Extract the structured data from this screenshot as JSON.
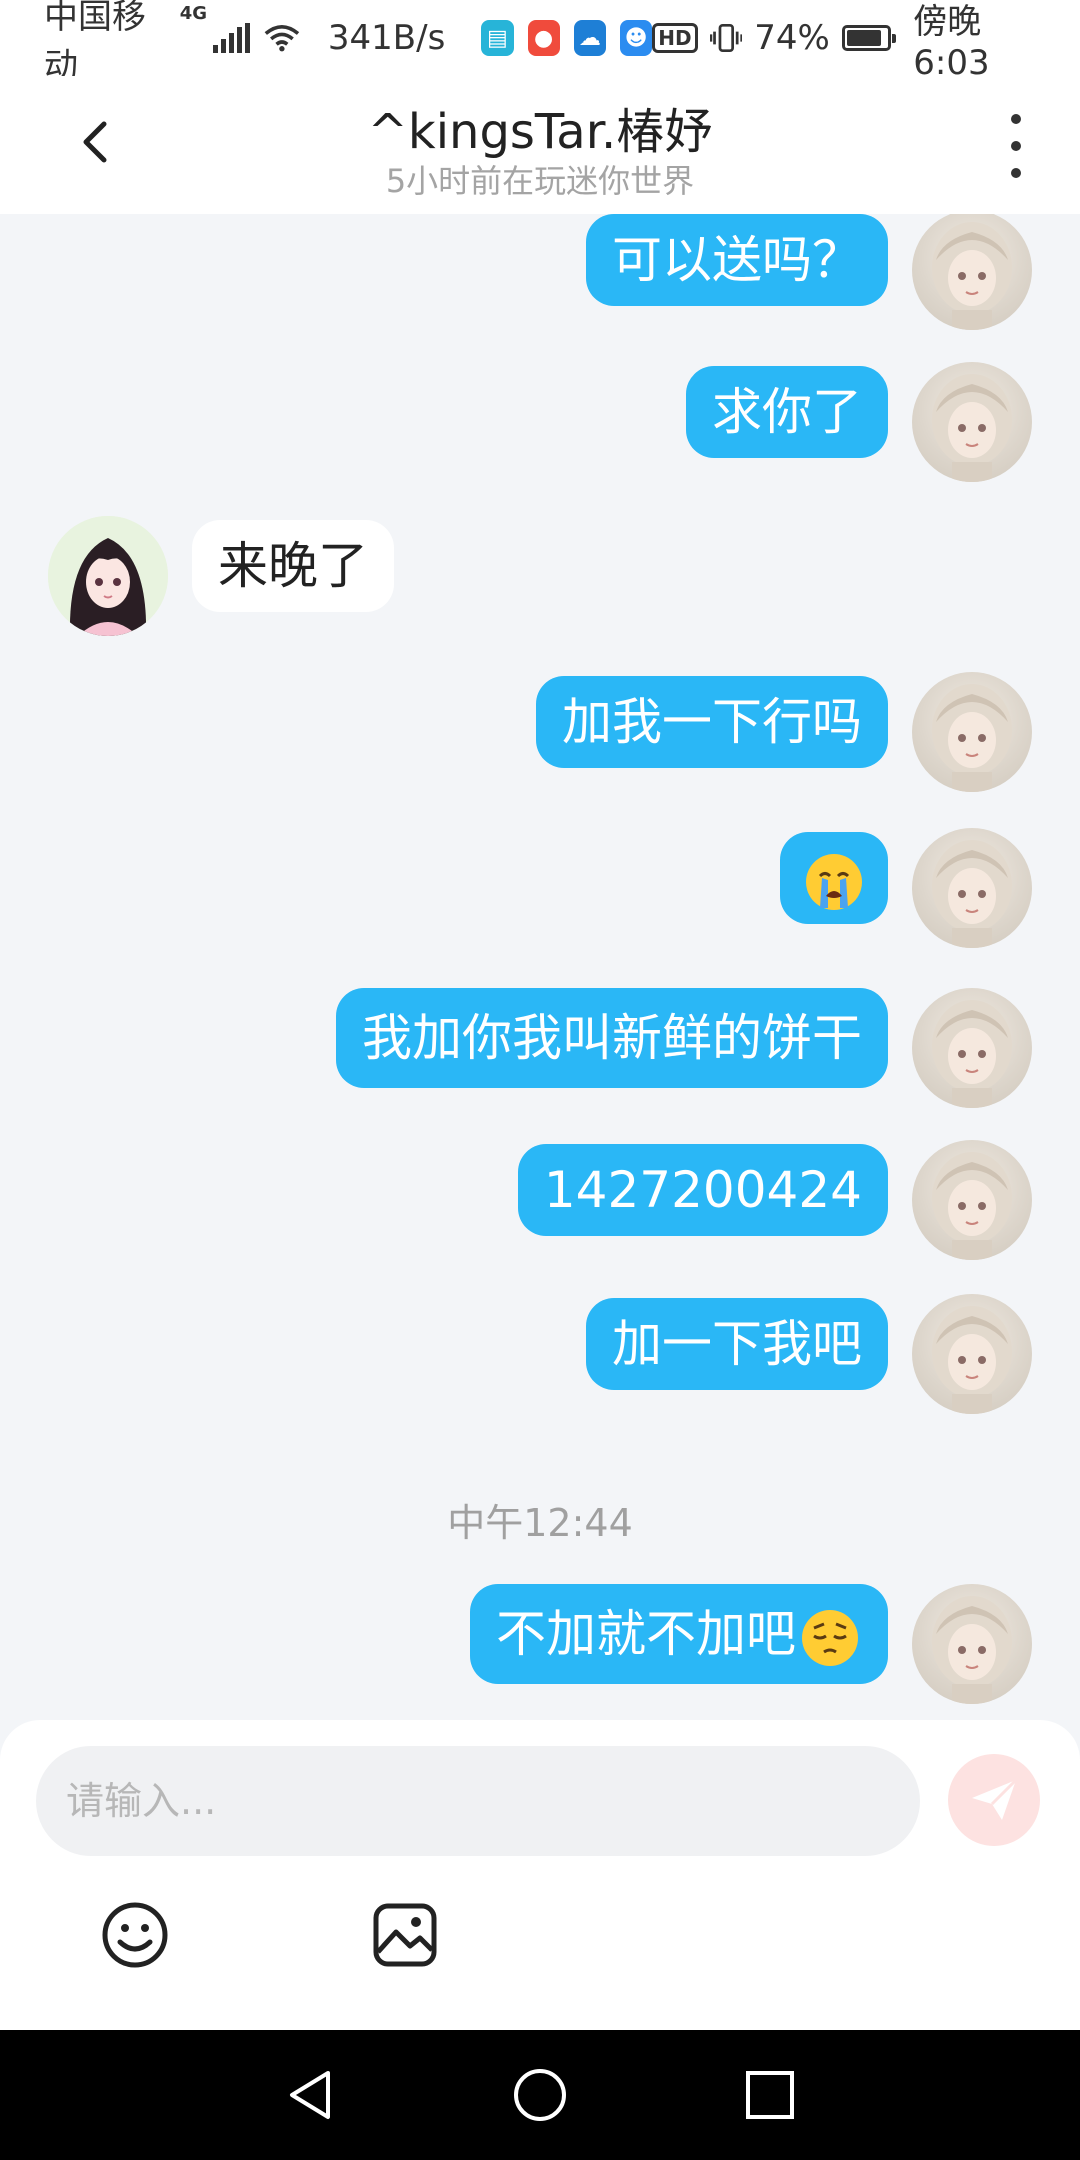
{
  "status_bar": {
    "carrier": "中国移动",
    "network": "4G",
    "speed": "341B/s",
    "hd_badge": "HD",
    "battery_text": "74%",
    "battery_level": 0.74,
    "time": "傍晚6:03"
  },
  "header": {
    "title": "^kingsTar.椿妤",
    "subtitle": "5小时前在玩迷你世界"
  },
  "messages": [
    {
      "side": "out",
      "text": "可以送吗？"
    },
    {
      "side": "out",
      "text": "求你了"
    },
    {
      "side": "in",
      "text": "来晚了"
    },
    {
      "side": "out",
      "text": "加我一下行吗"
    },
    {
      "side": "out",
      "text": "",
      "emoji": "crying-face"
    },
    {
      "side": "out",
      "text": "我加你我叫新鲜的饼干"
    },
    {
      "side": "out",
      "text": "1427200424"
    },
    {
      "side": "out",
      "text": "加一下我吧"
    },
    {
      "side": "out",
      "text": "不加就不加吧",
      "emoji": "pensive-face"
    }
  ],
  "timestamp": "中午12:44",
  "composer": {
    "placeholder": "请输入..."
  },
  "icons": {
    "back": "back-arrow-icon",
    "more": "more-vertical-icon",
    "emoji": "emoji-icon",
    "image": "image-icon",
    "send": "send-icon"
  },
  "colors": {
    "outgoing_bubble": "#2ab7f6",
    "incoming_bubble": "#ffffff",
    "send_button": "#fde2e1",
    "background": "#f3f5f8"
  }
}
